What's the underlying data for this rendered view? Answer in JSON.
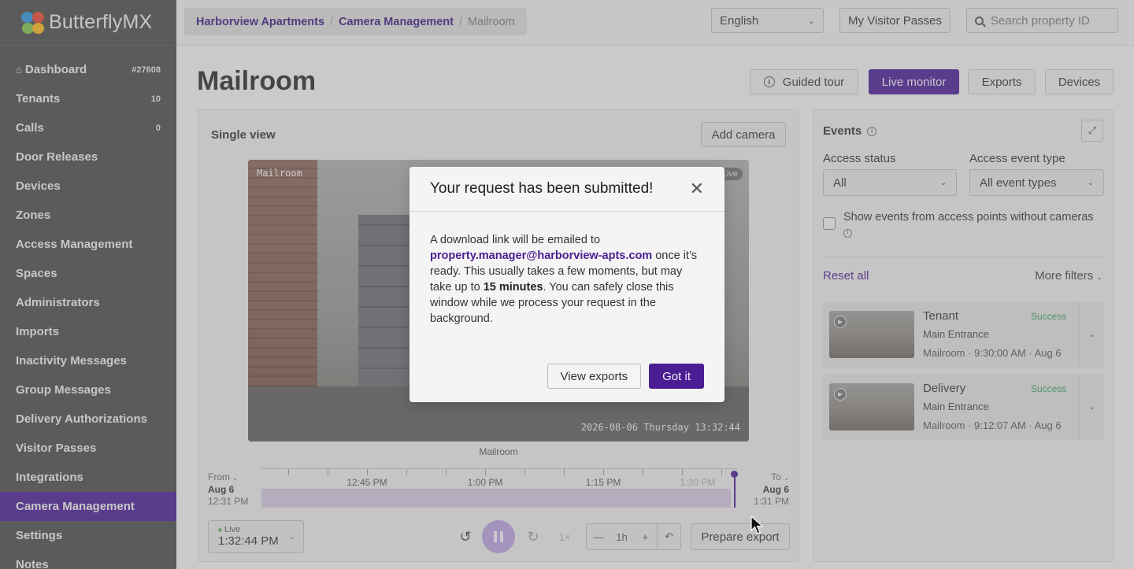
{
  "brand": {
    "name": "ButterflyMX"
  },
  "sidebar": {
    "items": [
      {
        "label": "Dashboard",
        "count": "#27608"
      },
      {
        "label": "Tenants",
        "count": "10"
      },
      {
        "label": "Calls",
        "count": "0"
      },
      {
        "label": "Door Releases"
      },
      {
        "label": "Devices"
      },
      {
        "label": "Zones"
      },
      {
        "label": "Access Management"
      },
      {
        "label": "Spaces"
      },
      {
        "label": "Administrators"
      },
      {
        "label": "Imports"
      },
      {
        "label": "Inactivity Messages"
      },
      {
        "label": "Group Messages"
      },
      {
        "label": "Delivery Authorizations"
      },
      {
        "label": "Visitor Passes"
      },
      {
        "label": "Integrations"
      },
      {
        "label": "Camera Management",
        "active": true
      },
      {
        "label": "Settings"
      },
      {
        "label": "Notes"
      }
    ]
  },
  "breadcrumb": {
    "items": [
      "Harborview Apartments",
      "Camera Management"
    ],
    "current": "Mailroom"
  },
  "topbar": {
    "language": "English",
    "visitor_passes": "My Visitor Passes",
    "search_placeholder": "Search property ID"
  },
  "header": {
    "title": "Mailroom",
    "guided_tour": "Guided tour",
    "live_monitor": "Live monitor",
    "exports": "Exports",
    "devices": "Devices"
  },
  "viewer": {
    "single_view": "Single view",
    "add_camera": "Add camera",
    "camera_label": "Mailroom",
    "live_tag": "Live",
    "timestamp": "2026-08-06 Thursday 13:32:44",
    "caption": "Mailroom",
    "from_label": "From",
    "from_date": "Aug 6",
    "from_time": "12:31 PM",
    "to_label": "To",
    "to_date": "Aug 6",
    "to_time": "1:31 PM",
    "timeline_labels": [
      "12:45 PM",
      "1:00 PM",
      "1:15 PM",
      "1:30 PM"
    ],
    "live_status": "Live",
    "live_time": "1:32:44 PM",
    "speed": "1×",
    "zoom_value": "1h",
    "prepare_export": "Prepare export"
  },
  "events": {
    "title": "Events",
    "access_status_label": "Access status",
    "access_status_value": "All",
    "event_type_label": "Access event type",
    "event_type_value": "All event types",
    "show_events_label": "Show events from access points without cameras",
    "reset_all": "Reset all",
    "more_filters": "More filters",
    "items": [
      {
        "type": "Tenant",
        "status": "Success",
        "location": "Main Entrance",
        "meta": "Mailroom · 9:30:00 AM · Aug 6"
      },
      {
        "type": "Delivery",
        "status": "Success",
        "location": "Main Entrance",
        "meta": "Mailroom · 9:12:07 AM · Aug 6"
      }
    ]
  },
  "modal": {
    "title": "Your request has been submitted!",
    "body_pre": "A download link will be emailed to",
    "email": "property.manager@harborview-apts.com",
    "body_mid": "once it’s ready. This usually takes a few moments, but may take up to",
    "body_bold": "15 minutes",
    "body_post": ". You can safely close this window while we process your request in the background.",
    "view_exports": "View exports",
    "got_it": "Got it"
  },
  "colors": {
    "brand_purple": "#4b1d92",
    "sidebar_bg": "#4a4a4c",
    "success_green": "#3a9a62"
  }
}
